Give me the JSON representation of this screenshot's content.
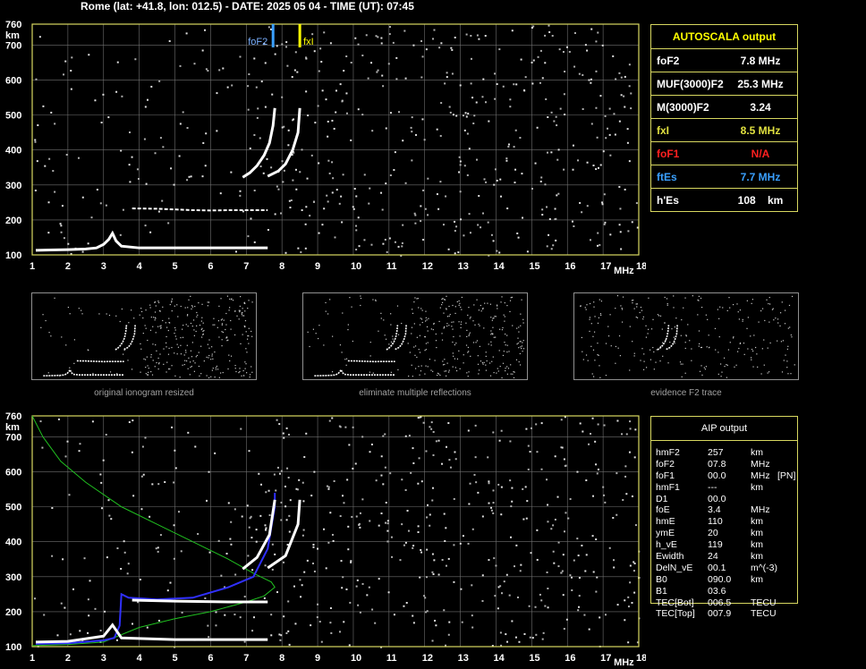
{
  "header": "Rome (lat: +41.8, lon: 012.5) - DATE: 2025 05 04 - TIME (UT): 07:45",
  "axes": {
    "y_ticks": [
      "760",
      "700",
      "600",
      "500",
      "400",
      "300",
      "200",
      "100"
    ],
    "y_unit": "km",
    "x_ticks": [
      "1",
      "2",
      "3",
      "4",
      "5",
      "6",
      "7",
      "8",
      "9",
      "10",
      "11",
      "12",
      "13",
      "14",
      "15",
      "16",
      "17",
      "18"
    ],
    "x_unit": "MHz"
  },
  "markers": {
    "foF2": "foF2",
    "fxI": "fxI"
  },
  "autoscala": {
    "title": "AUTOSCALA output",
    "rows": [
      {
        "label": "foF2",
        "value": "7.8 MHz",
        "color": "#ffffff"
      },
      {
        "label": "MUF(3000)F2",
        "value": "25.3 MHz",
        "color": "#ffffff"
      },
      {
        "label": "M(3000)F2",
        "value": "3.24",
        "color": "#ffffff"
      },
      {
        "label": "fxI",
        "value": "8.5 MHz",
        "color": "#e0e040"
      },
      {
        "label": "foF1",
        "value": "N/A",
        "color": "#ff2020"
      },
      {
        "label": "ftEs",
        "value": "7.7 MHz",
        "color": "#3aa0ff"
      },
      {
        "label": "h'Es",
        "value": "108    km",
        "color": "#ffffff"
      }
    ]
  },
  "thumbs": [
    "original ionogram resized",
    "eliminate multiple reflections",
    "evidence F2 trace"
  ],
  "aip": {
    "title": "AIP output",
    "rows": [
      [
        "hmF2",
        "257",
        "km",
        ""
      ],
      [
        "foF2",
        "07.8",
        "MHz",
        ""
      ],
      [
        "foF1",
        "00.0",
        "MHz",
        "[PN]"
      ],
      [
        "hmF1",
        "---",
        "km",
        ""
      ],
      [
        "D1",
        "00.0",
        "",
        ""
      ],
      [
        "foE",
        "3.4",
        "MHz",
        ""
      ],
      [
        "hmE",
        "110",
        "km",
        ""
      ],
      [
        "ymE",
        "20",
        "km",
        ""
      ],
      [
        "h_vE",
        "119",
        "km",
        ""
      ],
      [
        "Ewidth",
        "24",
        "km",
        ""
      ],
      [
        "DelN_vE",
        "00.1",
        "m^(-3)",
        ""
      ],
      [
        "B0",
        "090.0",
        "km",
        ""
      ],
      [
        "B1",
        "03.6",
        "",
        ""
      ],
      [
        "TEC[Bot]",
        "006.5",
        "TECU",
        ""
      ],
      [
        "TEC[Top]",
        "007.9",
        "TECU",
        ""
      ]
    ]
  },
  "chart_data": [
    {
      "type": "scatter",
      "title": "",
      "xlabel": "MHz",
      "ylabel": "km",
      "xlim": [
        1,
        18
      ],
      "ylim": [
        100,
        760
      ],
      "grid": true,
      "series": [
        {
          "values": [
            [
              1.1,
              113
            ],
            [
              1.5,
              114
            ],
            [
              2.0,
              115
            ],
            [
              2.5,
              117
            ],
            [
              2.8,
              120
            ],
            [
              3.0,
              130
            ],
            [
              3.15,
              145
            ],
            [
              3.25,
              162
            ],
            [
              3.35,
              140
            ],
            [
              3.5,
              125
            ],
            [
              4.0,
              120
            ],
            [
              5.0,
              120
            ],
            [
              6.0,
              120
            ],
            [
              7.0,
              120
            ],
            [
              7.6,
              120
            ]
          ]
        },
        {
          "values": [
            [
              3.8,
              233
            ],
            [
              4.5,
              232
            ],
            [
              5.0,
              230
            ],
            [
              5.5,
              228
            ],
            [
              6.0,
              227
            ],
            [
              6.5,
              228
            ],
            [
              7.0,
              228
            ],
            [
              7.6,
              228
            ]
          ]
        },
        {
          "values": [
            [
              6.9,
              322
            ],
            [
              7.1,
              335
            ],
            [
              7.3,
              355
            ],
            [
              7.5,
              385
            ],
            [
              7.65,
              420
            ],
            [
              7.75,
              470
            ],
            [
              7.8,
              520
            ]
          ]
        },
        {
          "values": [
            [
              7.6,
              325
            ],
            [
              7.9,
              340
            ],
            [
              8.1,
              360
            ],
            [
              8.3,
              400
            ],
            [
              8.45,
              450
            ],
            [
              8.5,
              520
            ]
          ]
        }
      ],
      "markers": [
        {
          "label": "foF2",
          "x": 7.75,
          "color": "#3aa0ff"
        },
        {
          "label": "fxI",
          "x": 8.5,
          "color": "#ffff00"
        }
      ]
    },
    {
      "type": "line",
      "title": "",
      "xlabel": "MHz",
      "ylabel": "km",
      "xlim": [
        1,
        18
      ],
      "ylim": [
        100,
        760
      ],
      "grid": true,
      "series": [
        {
          "values": [
            [
              1.0,
              760
            ],
            [
              1.3,
              700
            ],
            [
              1.8,
              630
            ],
            [
              2.5,
              570
            ],
            [
              3.5,
              500
            ],
            [
              4.5,
              450
            ],
            [
              5.5,
              400
            ],
            [
              6.5,
              350
            ],
            [
              7.2,
              310
            ],
            [
              7.7,
              285
            ],
            [
              7.8,
              270
            ],
            [
              7.5,
              245
            ],
            [
              7.0,
              228
            ],
            [
              6.0,
              200
            ],
            [
              5.0,
              180
            ],
            [
              4.0,
              155
            ],
            [
              3.4,
              130
            ],
            [
              3.0,
              113
            ],
            [
              2.0,
              106
            ],
            [
              1.0,
              103
            ]
          ],
          "color": "#20c020"
        },
        {
          "values": [
            [
              1.1,
              108
            ],
            [
              2.0,
              110
            ],
            [
              3.0,
              118
            ],
            [
              3.3,
              125
            ],
            [
              3.45,
              160
            ],
            [
              3.5,
              250
            ],
            [
              3.7,
              240
            ],
            [
              4.5,
              235
            ],
            [
              5.5,
              240
            ],
            [
              6.5,
              270
            ],
            [
              7.2,
              300
            ],
            [
              7.6,
              380
            ],
            [
              7.8,
              500
            ],
            [
              7.8,
              540
            ]
          ],
          "color": "#3030ff"
        },
        {
          "values": [
            [
              1.1,
              113
            ],
            [
              2.0,
              115
            ],
            [
              3.0,
              130
            ],
            [
              3.25,
              162
            ],
            [
              3.5,
              125
            ],
            [
              5.0,
              120
            ],
            [
              7.6,
              120
            ]
          ],
          "color": "#ffffff"
        },
        {
          "values": [
            [
              3.8,
              233
            ],
            [
              5.0,
              230
            ],
            [
              6.5,
              228
            ],
            [
              7.6,
              228
            ]
          ],
          "color": "#ffffff"
        },
        {
          "values": [
            [
              6.9,
              322
            ],
            [
              7.3,
              355
            ],
            [
              7.65,
              420
            ],
            [
              7.8,
              520
            ]
          ],
          "color": "#ffffff"
        },
        {
          "values": [
            [
              7.6,
              325
            ],
            [
              8.1,
              360
            ],
            [
              8.45,
              450
            ],
            [
              8.5,
              520
            ]
          ],
          "color": "#ffffff"
        }
      ]
    }
  ]
}
